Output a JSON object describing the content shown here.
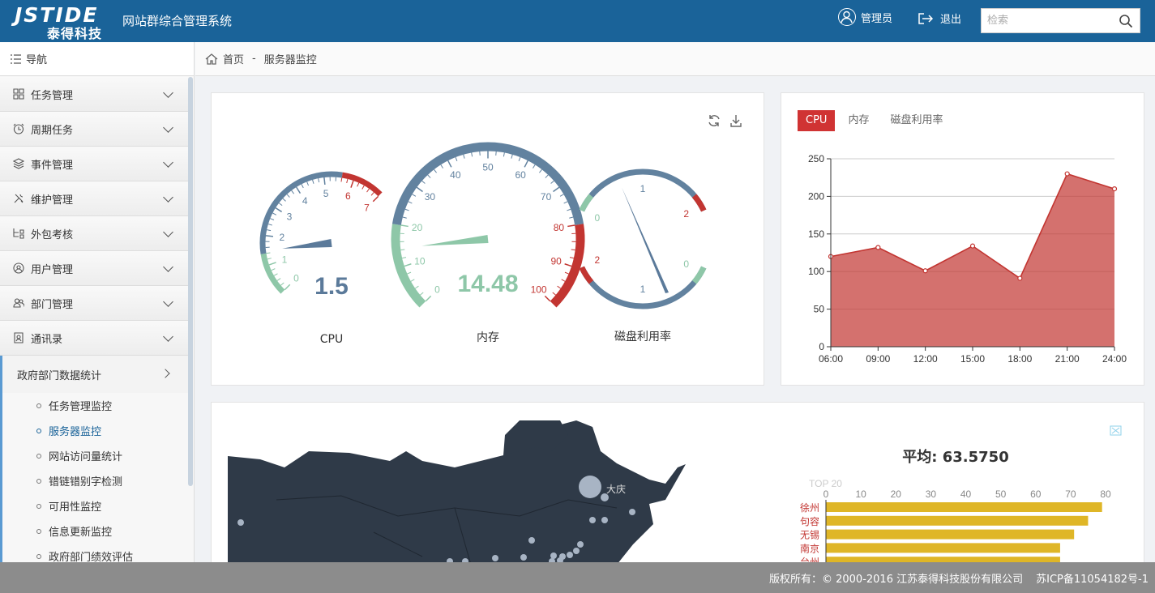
{
  "header": {
    "logo_en": "JSTIDE",
    "logo_cn": "泰得科技",
    "system_title": "网站群综合管理系统",
    "admin_label": "管理员",
    "logout_label": "退出",
    "search_placeholder": "检索"
  },
  "sidebar": {
    "nav_title": "导航",
    "items": [
      {
        "label": "任务管理",
        "icon": "grid-icon"
      },
      {
        "label": "周期任务",
        "icon": "alarm-clock-icon"
      },
      {
        "label": "事件管理",
        "icon": "layers-icon"
      },
      {
        "label": "维护管理",
        "icon": "tools-icon"
      },
      {
        "label": "外包考核",
        "icon": "flow-icon"
      },
      {
        "label": "用户管理",
        "icon": "user-icon"
      },
      {
        "label": "部门管理",
        "icon": "users-icon"
      },
      {
        "label": "通讯录",
        "icon": "contact-icon"
      }
    ],
    "open_group": "政府部门数据统计",
    "sub_items": [
      {
        "label": "任务管理监控",
        "active": false
      },
      {
        "label": "服务器监控",
        "active": true
      },
      {
        "label": "网站访问量统计",
        "active": false
      },
      {
        "label": "错链错别字检测",
        "active": false
      },
      {
        "label": "可用性监控",
        "active": false
      },
      {
        "label": "信息更新监控",
        "active": false
      },
      {
        "label": "政府部门绩效评估",
        "active": false
      }
    ]
  },
  "breadcrumb": {
    "home": "首页",
    "separator": "-",
    "current": "服务器监控"
  },
  "gauges": [
    {
      "name": "CPU",
      "value": 1.5,
      "min": 0,
      "max": 7,
      "ticks": [
        "0",
        "1",
        "2",
        "3",
        "4",
        "5",
        "6",
        "7"
      ],
      "value_color": "#5b7a9a"
    },
    {
      "name": "内存",
      "value": 14.48,
      "min": 0,
      "max": 100,
      "ticks": [
        "0",
        "10",
        "20",
        "30",
        "40",
        "50",
        "60",
        "70",
        "80",
        "90",
        "100"
      ],
      "value_color": "#8ec7a8"
    },
    {
      "name": "磁盘利用率",
      "value": 0.4,
      "min": 0,
      "max": 2,
      "ticks": [
        "0",
        "1",
        "2"
      ],
      "ticks_lower": [
        "2",
        "1",
        "0"
      ],
      "value_color": "#5b7a9a"
    }
  ],
  "gauge_toolbar": {
    "refresh_icon": "refresh-icon",
    "download_icon": "download-icon"
  },
  "gauge_colors": {
    "low": "#8ec7a8",
    "mid": "#62829f",
    "high": "#c23531"
  },
  "tabs": [
    {
      "label": "CPU",
      "active": true
    },
    {
      "label": "内存",
      "active": false
    },
    {
      "label": "磁盘利用率",
      "active": false
    }
  ],
  "chart_data": [
    {
      "type": "area",
      "x": [
        "06:00",
        "09:00",
        "12:00",
        "15:00",
        "18:00",
        "21:00",
        "24:00"
      ],
      "values": [
        120,
        132,
        101,
        134,
        91,
        230,
        210
      ],
      "ylim": [
        0,
        250
      ],
      "yticks": [
        0,
        50,
        100,
        150,
        200,
        250
      ],
      "color": "#c23531",
      "grid": true
    },
    {
      "type": "bar",
      "title": "平均: 63.5750",
      "subtitle": "TOP 20",
      "categories": [
        "徐州",
        "句容",
        "无锡",
        "南京",
        "台州"
      ],
      "values": [
        79,
        75,
        71,
        67,
        67
      ],
      "xlim": [
        0,
        80
      ],
      "xticks": [
        0,
        10,
        20,
        30,
        40,
        50,
        60,
        70,
        80
      ],
      "color": "#dfb627",
      "label_color": "#c23531"
    }
  ],
  "map": {
    "city_label": "大庆",
    "bg": "#2f3a48",
    "dot_color": "#a8b4c4"
  },
  "footer": {
    "copyright": "版权所有：© 2000-2016 江苏泰得科技股份有限公司",
    "icp": "苏ICP备11054182号-1"
  }
}
